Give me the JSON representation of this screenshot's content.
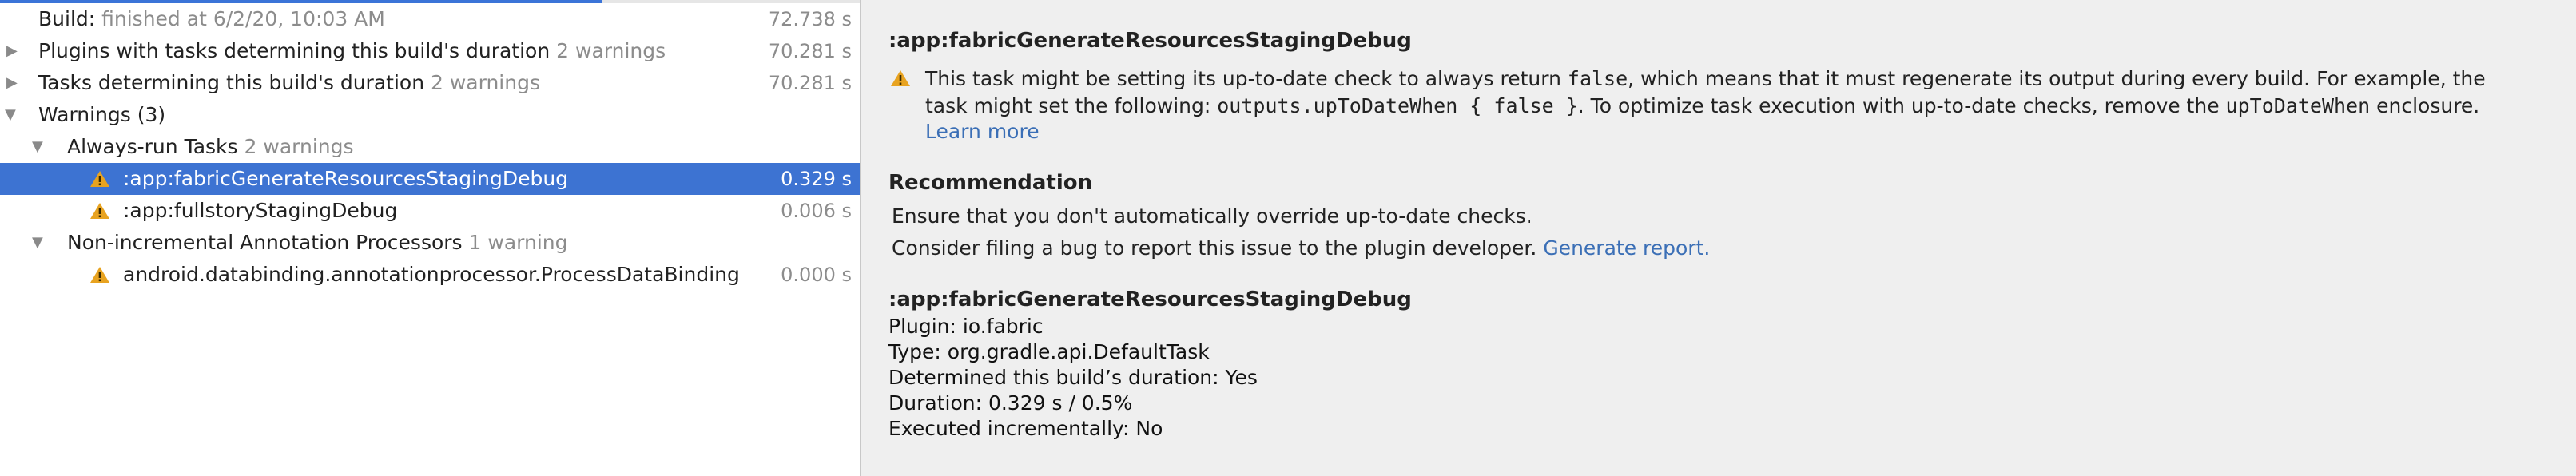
{
  "tree": {
    "rows": [
      {
        "label": "Build:",
        "muted": "finished at 6/2/20, 10:03 AM",
        "time": "72.738 s"
      },
      {
        "label": "Plugins with tasks determining this build's duration",
        "muted": "2 warnings",
        "time": "70.281 s"
      },
      {
        "label": "Tasks determining this build's duration",
        "muted": "2 warnings",
        "time": "70.281 s"
      },
      {
        "label": "Warnings (3)",
        "muted": "",
        "time": ""
      },
      {
        "label": "Always-run Tasks",
        "muted": "2 warnings",
        "time": ""
      },
      {
        "label": ":app:fabricGenerateResourcesStagingDebug",
        "muted": "",
        "time": "0.329 s"
      },
      {
        "label": ":app:fullstoryStagingDebug",
        "muted": "",
        "time": "0.006 s"
      },
      {
        "label": "Non-incremental Annotation Processors",
        "muted": "1 warning",
        "time": ""
      },
      {
        "label": "android.databinding.annotationprocessor.ProcessDataBinding",
        "muted": "",
        "time": "0.000 s"
      }
    ]
  },
  "detail": {
    "title": ":app:fabricGenerateResourcesStagingDebug",
    "warning": {
      "line1_a": "This task might be setting its up-to-date check to always return ",
      "line1_code": "false",
      "line1_b": ", which means that it must regenerate its output during every build. For example, the",
      "line2_a": "task might set the following: ",
      "line2_code": "outputs.upToDateWhen { false }",
      "line2_b": ". To optimize task execution with up-to-date checks, remove the ",
      "line2_code2": "upToDateWhen",
      "line2_c": " enclosure.",
      "learn_more": "Learn more"
    },
    "recommendation": {
      "heading": "Recommendation",
      "line1": "Ensure that you don't automatically override up-to-date checks.",
      "line2": "Consider filing a bug to report this issue to the plugin developer.",
      "link": "Generate report."
    },
    "info": {
      "title": ":app:fabricGenerateResourcesStagingDebug",
      "plugin": "Plugin: io.fabric",
      "type": "Type: org.gradle.api.DefaultTask",
      "determined": "Determined this build’s duration: Yes",
      "duration": "Duration: 0.329 s / 0.5%",
      "incremental": "Executed incrementally: No"
    }
  },
  "colors": {
    "selection": "#3d73d2",
    "warning": "#e8a320",
    "link": "#3b6fb6"
  },
  "progress_fraction": 0.234
}
